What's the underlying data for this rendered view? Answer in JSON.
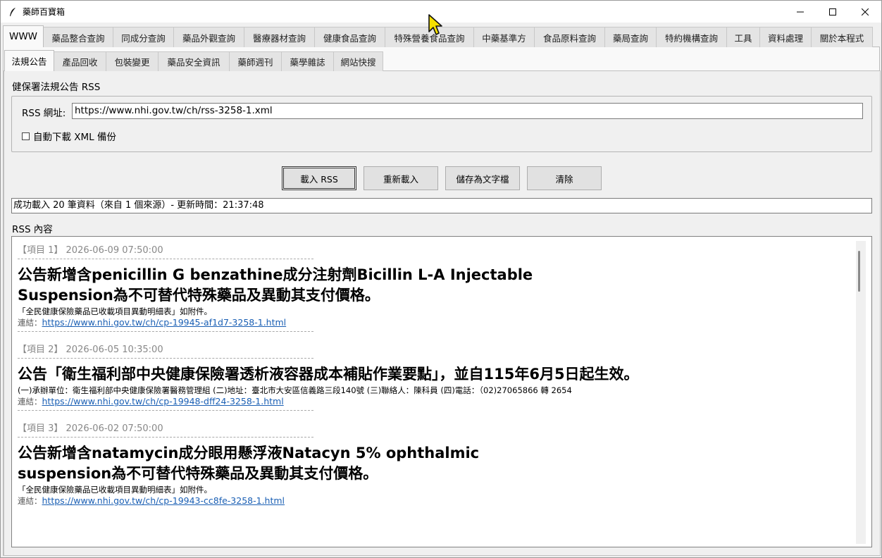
{
  "window": {
    "title": "藥師百寶箱"
  },
  "main_tabs": [
    "WWW",
    "藥品整合查詢",
    "同成分查詢",
    "藥品外觀查詢",
    "醫療器材查詢",
    "健康食品查詢",
    "特殊營養食品查詢",
    "中藥基準方",
    "食品原料查詢",
    "藥局查詢",
    "特約機構查詢",
    "工具",
    "資料處理",
    "關於本程式"
  ],
  "sub_tabs": [
    "法規公告",
    "產品回收",
    "包裝變更",
    "藥品安全資訊",
    "藥師週刊",
    "藥學雜誌",
    "網站快搜"
  ],
  "rss": {
    "group_title": "健保署法規公告 RSS",
    "url_label": "RSS 網址:",
    "url_value": "https://www.nhi.gov.tw/ch/rss-3258-1.xml",
    "auto_download_label": "自動下載 XML 備份"
  },
  "buttons": {
    "load": "載入 RSS",
    "reload": "重新載入",
    "save": "儲存為文字檔",
    "clear": "清除"
  },
  "status_text": "成功載入 20 筆資料（來自 1 個來源）- 更新時間：21:37:48",
  "content_label": "RSS 內容",
  "items": [
    {
      "head": "【項目 1】 2026-06-09 07:50:00",
      "title_line1": "公告新增含penicillin G benzathine成分注射劑Bicillin L-A Injectable",
      "title_line2": "Suspension為不可替代特殊藥品及異動其支付價格。",
      "desc": "「全民健康保險藥品已收載項目異動明細表」如附件。",
      "link_prefix": "連結：",
      "link": "https://www.nhi.gov.tw/ch/cp-19945-af1d7-3258-1.html"
    },
    {
      "head": "【項目 2】 2026-06-05 10:35:00",
      "title_line1": "公告「衛生福利部中央健康保險署透析液容器成本補貼作業要點」，並自115年6月5日起生效。",
      "title_line2": "",
      "desc": "(一)承辦單位：衛生福利部中央健康保險署醫務管理組 (二)地址：臺北市大安區信義路三段140號 (三)聯絡人：陳科員 (四)電話：（02)27065866 轉 2654",
      "link_prefix": "連結：",
      "link": "https://www.nhi.gov.tw/ch/cp-19948-dff24-3258-1.html"
    },
    {
      "head": "【項目 3】 2026-06-02 07:50:00",
      "title_line1": "公告新增含natamycin成分眼用懸浮液Natacyn 5% ophthalmic",
      "title_line2": "suspension為不可替代特殊藥品及異動其支付價格。",
      "desc": "「全民健康保險藥品已收載項目異動明細表」如附件。",
      "link_prefix": "連結：",
      "link": "https://www.nhi.gov.tw/ch/cp-19943-cc8fe-3258-1.html"
    }
  ]
}
